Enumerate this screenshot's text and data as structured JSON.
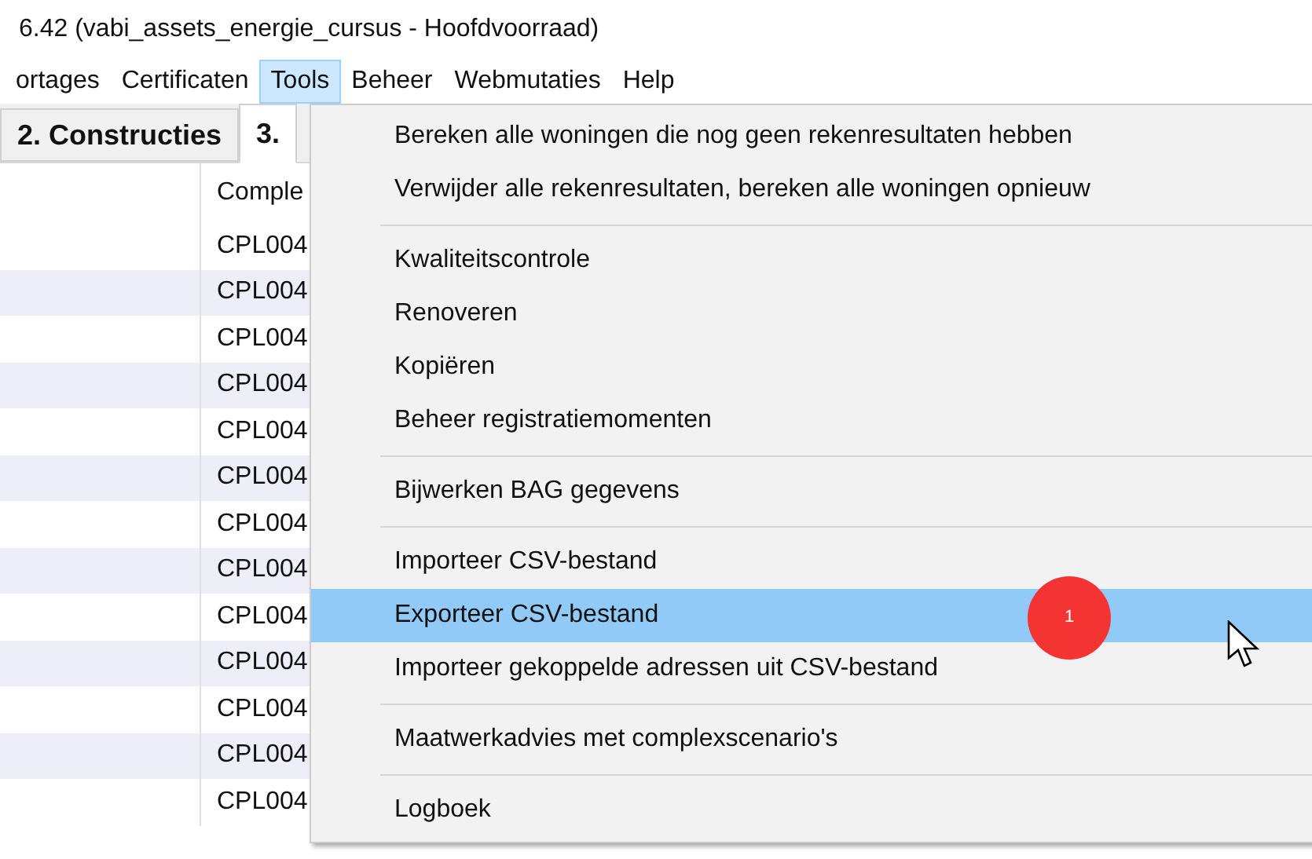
{
  "window": {
    "title": "6.42 (vabi_assets_energie_cursus - Hoofdvoorraad)"
  },
  "menu_bar": [
    {
      "label": "ortages",
      "selected": false
    },
    {
      "label": "Certificaten",
      "selected": false
    },
    {
      "label": "Tools",
      "selected": true
    },
    {
      "label": "Beheer",
      "selected": false
    },
    {
      "label": "Webmutaties",
      "selected": false
    },
    {
      "label": "Help",
      "selected": false
    }
  ],
  "tabs": [
    {
      "label": "2. Constructies",
      "selected": false
    },
    {
      "label": "3.",
      "selected": true
    }
  ],
  "table": {
    "columns": [
      "Comple"
    ],
    "rows": [
      "CPL004",
      "CPL004",
      "CPL004",
      "CPL004",
      "CPL004",
      "CPL004",
      "CPL004",
      "CPL004",
      "CPL004",
      "CPL004",
      "CPL004",
      "CPL004",
      "CPL004"
    ]
  },
  "dropdown_menu": {
    "items": [
      {
        "kind": "item",
        "label": "Bereken alle woningen die nog geen rekenresultaten hebben",
        "selected": false
      },
      {
        "kind": "item",
        "label": "Verwijder alle rekenresultaten, bereken alle woningen opnieuw",
        "selected": false
      },
      {
        "kind": "separator"
      },
      {
        "kind": "item",
        "label": "Kwaliteitscontrole",
        "selected": false
      },
      {
        "kind": "item",
        "label": "Renoveren",
        "selected": false
      },
      {
        "kind": "item",
        "label": "Kopiëren",
        "selected": false
      },
      {
        "kind": "item",
        "label": "Beheer registratiemomenten",
        "selected": false
      },
      {
        "kind": "separator"
      },
      {
        "kind": "item",
        "label": "Bijwerken BAG gegevens",
        "selected": false
      },
      {
        "kind": "separator"
      },
      {
        "kind": "item",
        "label": "Importeer CSV-bestand",
        "selected": false
      },
      {
        "kind": "item",
        "label": "Exporteer CSV-bestand",
        "selected": true
      },
      {
        "kind": "item",
        "label": "Importeer gekoppelde adressen uit CSV-bestand",
        "selected": false
      },
      {
        "kind": "separator"
      },
      {
        "kind": "item",
        "label": "Maatwerkadvies met complexscenario's",
        "selected": false
      },
      {
        "kind": "separator"
      },
      {
        "kind": "item",
        "label": "Logboek",
        "selected": false
      }
    ]
  },
  "step_badge": "1"
}
